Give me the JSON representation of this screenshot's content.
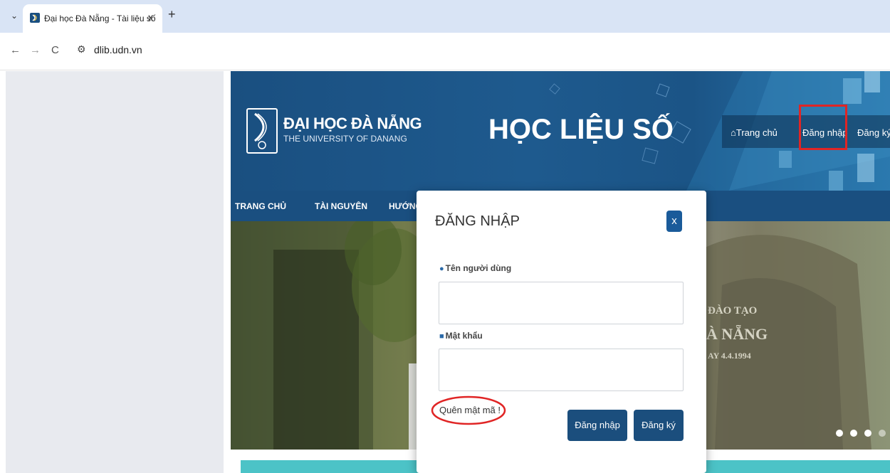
{
  "browser": {
    "tab_title": "Đại học Đà Nẵng - Tài liệu số",
    "tab_close": "x",
    "new_tab": "+",
    "url": "dlib.udn.vn",
    "menu_icon": "⌄",
    "back_icon": "←",
    "forward_icon": "→",
    "reload_icon": "C",
    "site_info_icon": "⚙"
  },
  "header": {
    "university_name": "ĐẠI HỌC ĐÀ NẴNG",
    "university_subtitle": "THE UNIVERSITY OF DANANG",
    "site_title": "HỌC LIỆU SỐ",
    "links": {
      "home": "Trang chủ",
      "login": "Đăng nhập",
      "register": "Đăng ký"
    }
  },
  "nav": {
    "items": [
      "TRANG CHỦ",
      "TÀI NGUYÊN",
      "HƯỚNG"
    ]
  },
  "hero": {
    "stone_lines": [
      "ĐÀO TẠO",
      "À NẴNG",
      "AY 4.4.1994"
    ]
  },
  "modal": {
    "title": "ĐĂNG NHẬP",
    "close_label": "x",
    "username_label": "Tên người dùng",
    "password_label": "Mật khẩu",
    "username_value": "",
    "password_value": "",
    "forgot_label": "Quên mật mã !",
    "login_button": "Đăng nhập",
    "register_button": "Đăng ký"
  },
  "colors": {
    "banner": "#1a4f80",
    "button": "#1b4e7d",
    "teal": "#4cc3c7",
    "annotation_red": "#e02525"
  }
}
